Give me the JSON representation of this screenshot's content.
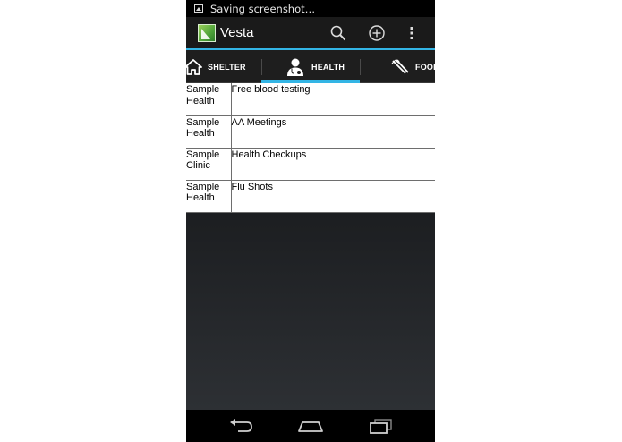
{
  "status_bar": {
    "notification_text": "Saving screenshot…",
    "notification_icon": "image-icon"
  },
  "action_bar": {
    "title": "Vesta",
    "logo_icon": "vesta-logo-icon",
    "actions": [
      {
        "icon": "search-icon"
      },
      {
        "icon": "add-icon"
      },
      {
        "icon": "overflow-menu-icon"
      }
    ],
    "accent_color": "#33b5e5"
  },
  "tabs": [
    {
      "label": "SHELTER",
      "icon": "home-icon"
    },
    {
      "label": "HEALTH",
      "icon": "doctor-icon",
      "selected": true
    },
    {
      "label": "FOOD",
      "icon": "utensils-icon"
    }
  ],
  "list": {
    "rows": [
      {
        "org": "Sample Health",
        "service": "Free blood testing"
      },
      {
        "org": "Sample Health",
        "service": "AA Meetings"
      },
      {
        "org": "Sample Clinic",
        "service": "Health Checkups"
      },
      {
        "org": "Sample Health",
        "service": "Flu Shots"
      }
    ]
  },
  "nav_bar": {
    "buttons": [
      {
        "icon": "back-icon"
      },
      {
        "icon": "home-icon"
      },
      {
        "icon": "recent-apps-icon"
      }
    ]
  }
}
